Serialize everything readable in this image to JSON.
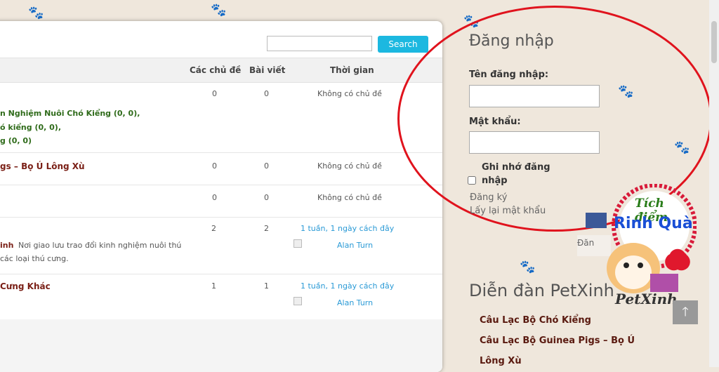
{
  "search": {
    "button_label": "Search",
    "placeholder": ""
  },
  "table": {
    "headers": {
      "topics": "Các chủ đề",
      "posts": "Bài viết",
      "time": "Thời gian"
    },
    "rows": [
      {
        "title": "",
        "subforums": [
          "n Nghiệm Nuôi Chó Kiểng (0, 0),",
          "ó kiểng (0, 0),",
          "g (0, 0)"
        ],
        "topics": "0",
        "posts": "0",
        "last": "Không có chủ đề"
      },
      {
        "title": "gs – Bọ Ú Lông Xù",
        "topics": "0",
        "posts": "0",
        "last": "Không có chủ đề"
      },
      {
        "title": "",
        "topics": "0",
        "posts": "0",
        "last": "Không có chủ đề"
      },
      {
        "title_bold": "inh",
        "desc1": "Nơi giao lưu trao đổi kinh nghiệm nuôi thú",
        "desc2": "các loại thú cưng.",
        "topics": "2",
        "posts": "2",
        "last": "1 tuần, 1 ngày cách đây",
        "author": "Alan Turn"
      },
      {
        "title": "Cưng Khác",
        "topics": "1",
        "posts": "1",
        "last": "1 tuần, 1 ngày cách đây",
        "author": "Alan Turn"
      }
    ]
  },
  "login": {
    "title": "Đăng nhập",
    "username_label": "Tên đăng nhập:",
    "password_label": "Mật khẩu:",
    "remember_line1": "Ghi nhớ đăng",
    "remember_line2": "nhập",
    "register": "Đăng ký",
    "recover": "Lấy lại mật khẩu"
  },
  "fb_partial": "Đăn",
  "forum": {
    "title": "Diễn đàn PetXinh",
    "links": [
      "Câu Lạc Bộ Chó Kiểng",
      "Câu Lạc Bộ Guinea Pigs – Bọ Ú",
      "Lông Xù"
    ]
  },
  "badge": {
    "line1": "Tích điểm",
    "line2": "Rinh Quà",
    "brand": "PetXinh"
  },
  "colors": {
    "accent": "#1cb8e0",
    "circle": "#e0131d",
    "title": "#7a1f16"
  }
}
